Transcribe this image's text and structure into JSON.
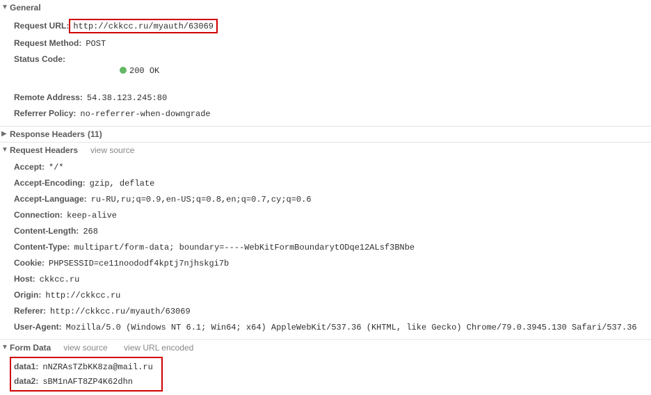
{
  "sections": {
    "general": {
      "title": "General",
      "fields": {
        "request_url": {
          "label": "Request URL:",
          "value": "http://ckkcc.ru/myauth/63069"
        },
        "request_method": {
          "label": "Request Method:",
          "value": "POST"
        },
        "status_code": {
          "label": "Status Code:",
          "value": "200 OK"
        },
        "remote_address": {
          "label": "Remote Address:",
          "value": "54.38.123.245:80"
        },
        "referrer_policy": {
          "label": "Referrer Policy:",
          "value": "no-referrer-when-downgrade"
        }
      }
    },
    "response_headers": {
      "title": "Response Headers",
      "count": "(11)"
    },
    "request_headers": {
      "title": "Request Headers",
      "links": {
        "view_source": "view source"
      },
      "fields": {
        "accept": {
          "label": "Accept:",
          "value": "*/*"
        },
        "accept_encoding": {
          "label": "Accept-Encoding:",
          "value": "gzip, deflate"
        },
        "accept_language": {
          "label": "Accept-Language:",
          "value": "ru-RU,ru;q=0.9,en-US;q=0.8,en;q=0.7,cy;q=0.6"
        },
        "connection": {
          "label": "Connection:",
          "value": "keep-alive"
        },
        "content_length": {
          "label": "Content-Length:",
          "value": "268"
        },
        "content_type": {
          "label": "Content-Type:",
          "value": "multipart/form-data; boundary=----WebKitFormBoundarytODqe12ALsf3BNbe"
        },
        "cookie": {
          "label": "Cookie:",
          "value": "PHPSESSID=ce11noododf4kptj7njhskgi7b"
        },
        "host": {
          "label": "Host:",
          "value": "ckkcc.ru"
        },
        "origin": {
          "label": "Origin:",
          "value": "http://ckkcc.ru"
        },
        "referer": {
          "label": "Referer:",
          "value": "http://ckkcc.ru/myauth/63069"
        },
        "user_agent": {
          "label": "User-Agent:",
          "value": "Mozilla/5.0 (Windows NT 6.1; Win64; x64) AppleWebKit/537.36 (KHTML, like Gecko) Chrome/79.0.3945.130 Safari/537.36"
        }
      }
    },
    "form_data": {
      "title": "Form Data",
      "links": {
        "view_source": "view source",
        "view_url_encoded": "view URL encoded"
      },
      "fields": {
        "data1": {
          "label": "data1:",
          "value": "nNZRAsTZbKK8za@mail.ru"
        },
        "data2": {
          "label": "data2:",
          "value": "sBM1nAFT8ZP4K62dhn"
        }
      }
    }
  }
}
